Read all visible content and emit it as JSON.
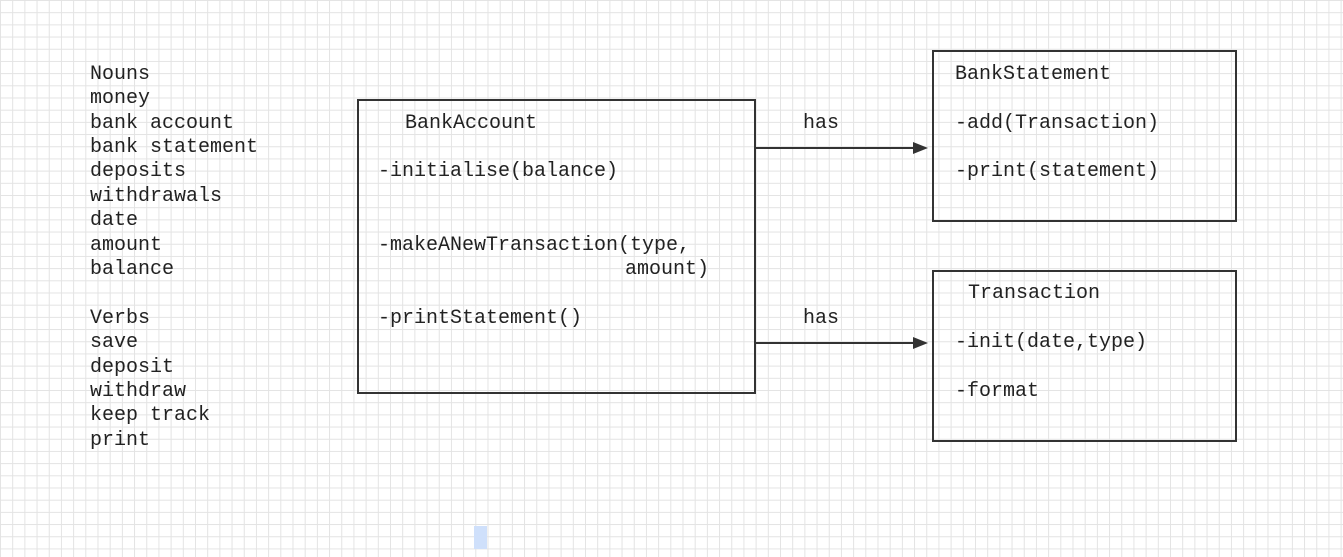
{
  "notes": {
    "nouns_heading": "Nouns",
    "nouns": [
      "money",
      "bank account",
      "bank statement",
      "deposits",
      "withdrawals",
      "date",
      "amount",
      "balance"
    ],
    "verbs_heading": "Verbs",
    "verbs": [
      "save",
      "deposit",
      "withdraw",
      "keep track",
      "print"
    ]
  },
  "classes": {
    "bank_account": {
      "title": "BankAccount",
      "method_initialise": "-initialise(balance)",
      "method_transaction_line1": "-makeANewTransaction(type,",
      "method_transaction_line2": "amount)",
      "method_print": "-printStatement()"
    },
    "bank_statement": {
      "title": "BankStatement",
      "method_add": "-add(Transaction)",
      "method_print": "-print(statement)"
    },
    "transaction": {
      "title": "Transaction",
      "method_init": "-init(date,type)",
      "method_format": "-format"
    }
  },
  "relations": {
    "statement_label": "has",
    "transaction_label": "has"
  },
  "colors": {
    "line": "#333333",
    "text": "#222222",
    "grid": "#e3e3e3",
    "selection": "#cfe0fb"
  }
}
